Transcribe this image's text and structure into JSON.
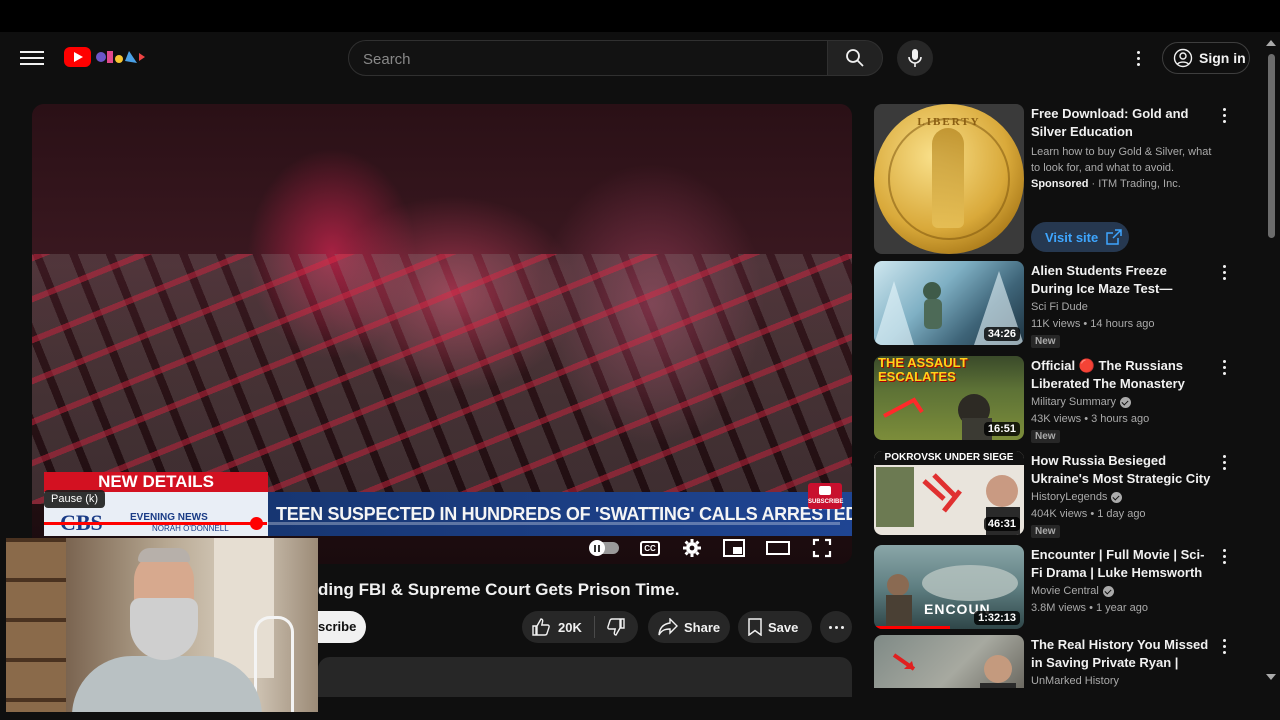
{
  "masthead": {
    "search_placeholder": "Search",
    "signin_label": "Sign in"
  },
  "player": {
    "tooltip": "Pause (k)",
    "lower_third": {
      "tag": "NEW DETAILS",
      "network": "CBS",
      "program": "EVENING NEWS",
      "anchor": "NORAH O'DONNELL",
      "headline": "TEEN SUSPECTED IN HUNDREDS OF 'SWATTING' CALLS ARRESTED"
    },
    "subscribe_bug": "SUBSCRIBE",
    "progress_fraction": 0.28,
    "cc_label": "CC"
  },
  "video": {
    "title_visible": "ding FBI & Supreme Court Gets Prison Time.",
    "subscribe_visible": "scribe",
    "likes": "20K",
    "share_label": "Share",
    "save_label": "Save"
  },
  "sidebar": {
    "ad": {
      "title": "Free Download: Gold and Silver Education",
      "description": "Learn how to buy Gold & Silver, what to look for, and what to avoid.",
      "sponsored": "Sponsored",
      "advertiser": "ITM Trading, Inc.",
      "cta": "Visit site",
      "coin_text": "LIBERTY"
    },
    "videos": [
      {
        "title": "Alien Students Freeze During Ice Maze Test—Human Slides…",
        "channel": "Sci Fi Dude",
        "verified": false,
        "views": "11K views",
        "age": "14 hours ago",
        "badge": "New",
        "duration": "34:26"
      },
      {
        "title": "Official 🔴 The Russians Liberated The Monastery And…",
        "channel": "Military Summary",
        "verified": true,
        "views": "43K views",
        "age": "3 hours ago",
        "badge": "New",
        "duration": "16:51",
        "thumb_text": "THE ASSAULT ESCALATES"
      },
      {
        "title": "How Russia Besieged Ukraine's Most Strategic City in Donbas",
        "channel": "HistoryLegends",
        "verified": true,
        "views": "404K views",
        "age": "1 day ago",
        "badge": "New",
        "duration": "46:31",
        "thumb_text": "POKROVSK UNDER SIEGE"
      },
      {
        "title": "Encounter | Full Movie | Sci-Fi Drama | Luke Hemsworth",
        "channel": "Movie Central",
        "verified": true,
        "views": "3.8M views",
        "age": "1 year ago",
        "badge": "",
        "duration": "1:32:13",
        "thumb_text": "ENCOUN"
      },
      {
        "title": "The Real History You Missed in Saving Private Ryan | Historian…",
        "channel": "UnMarked History",
        "verified": false,
        "views": "",
        "age": "",
        "badge": "",
        "duration": ""
      }
    ]
  }
}
